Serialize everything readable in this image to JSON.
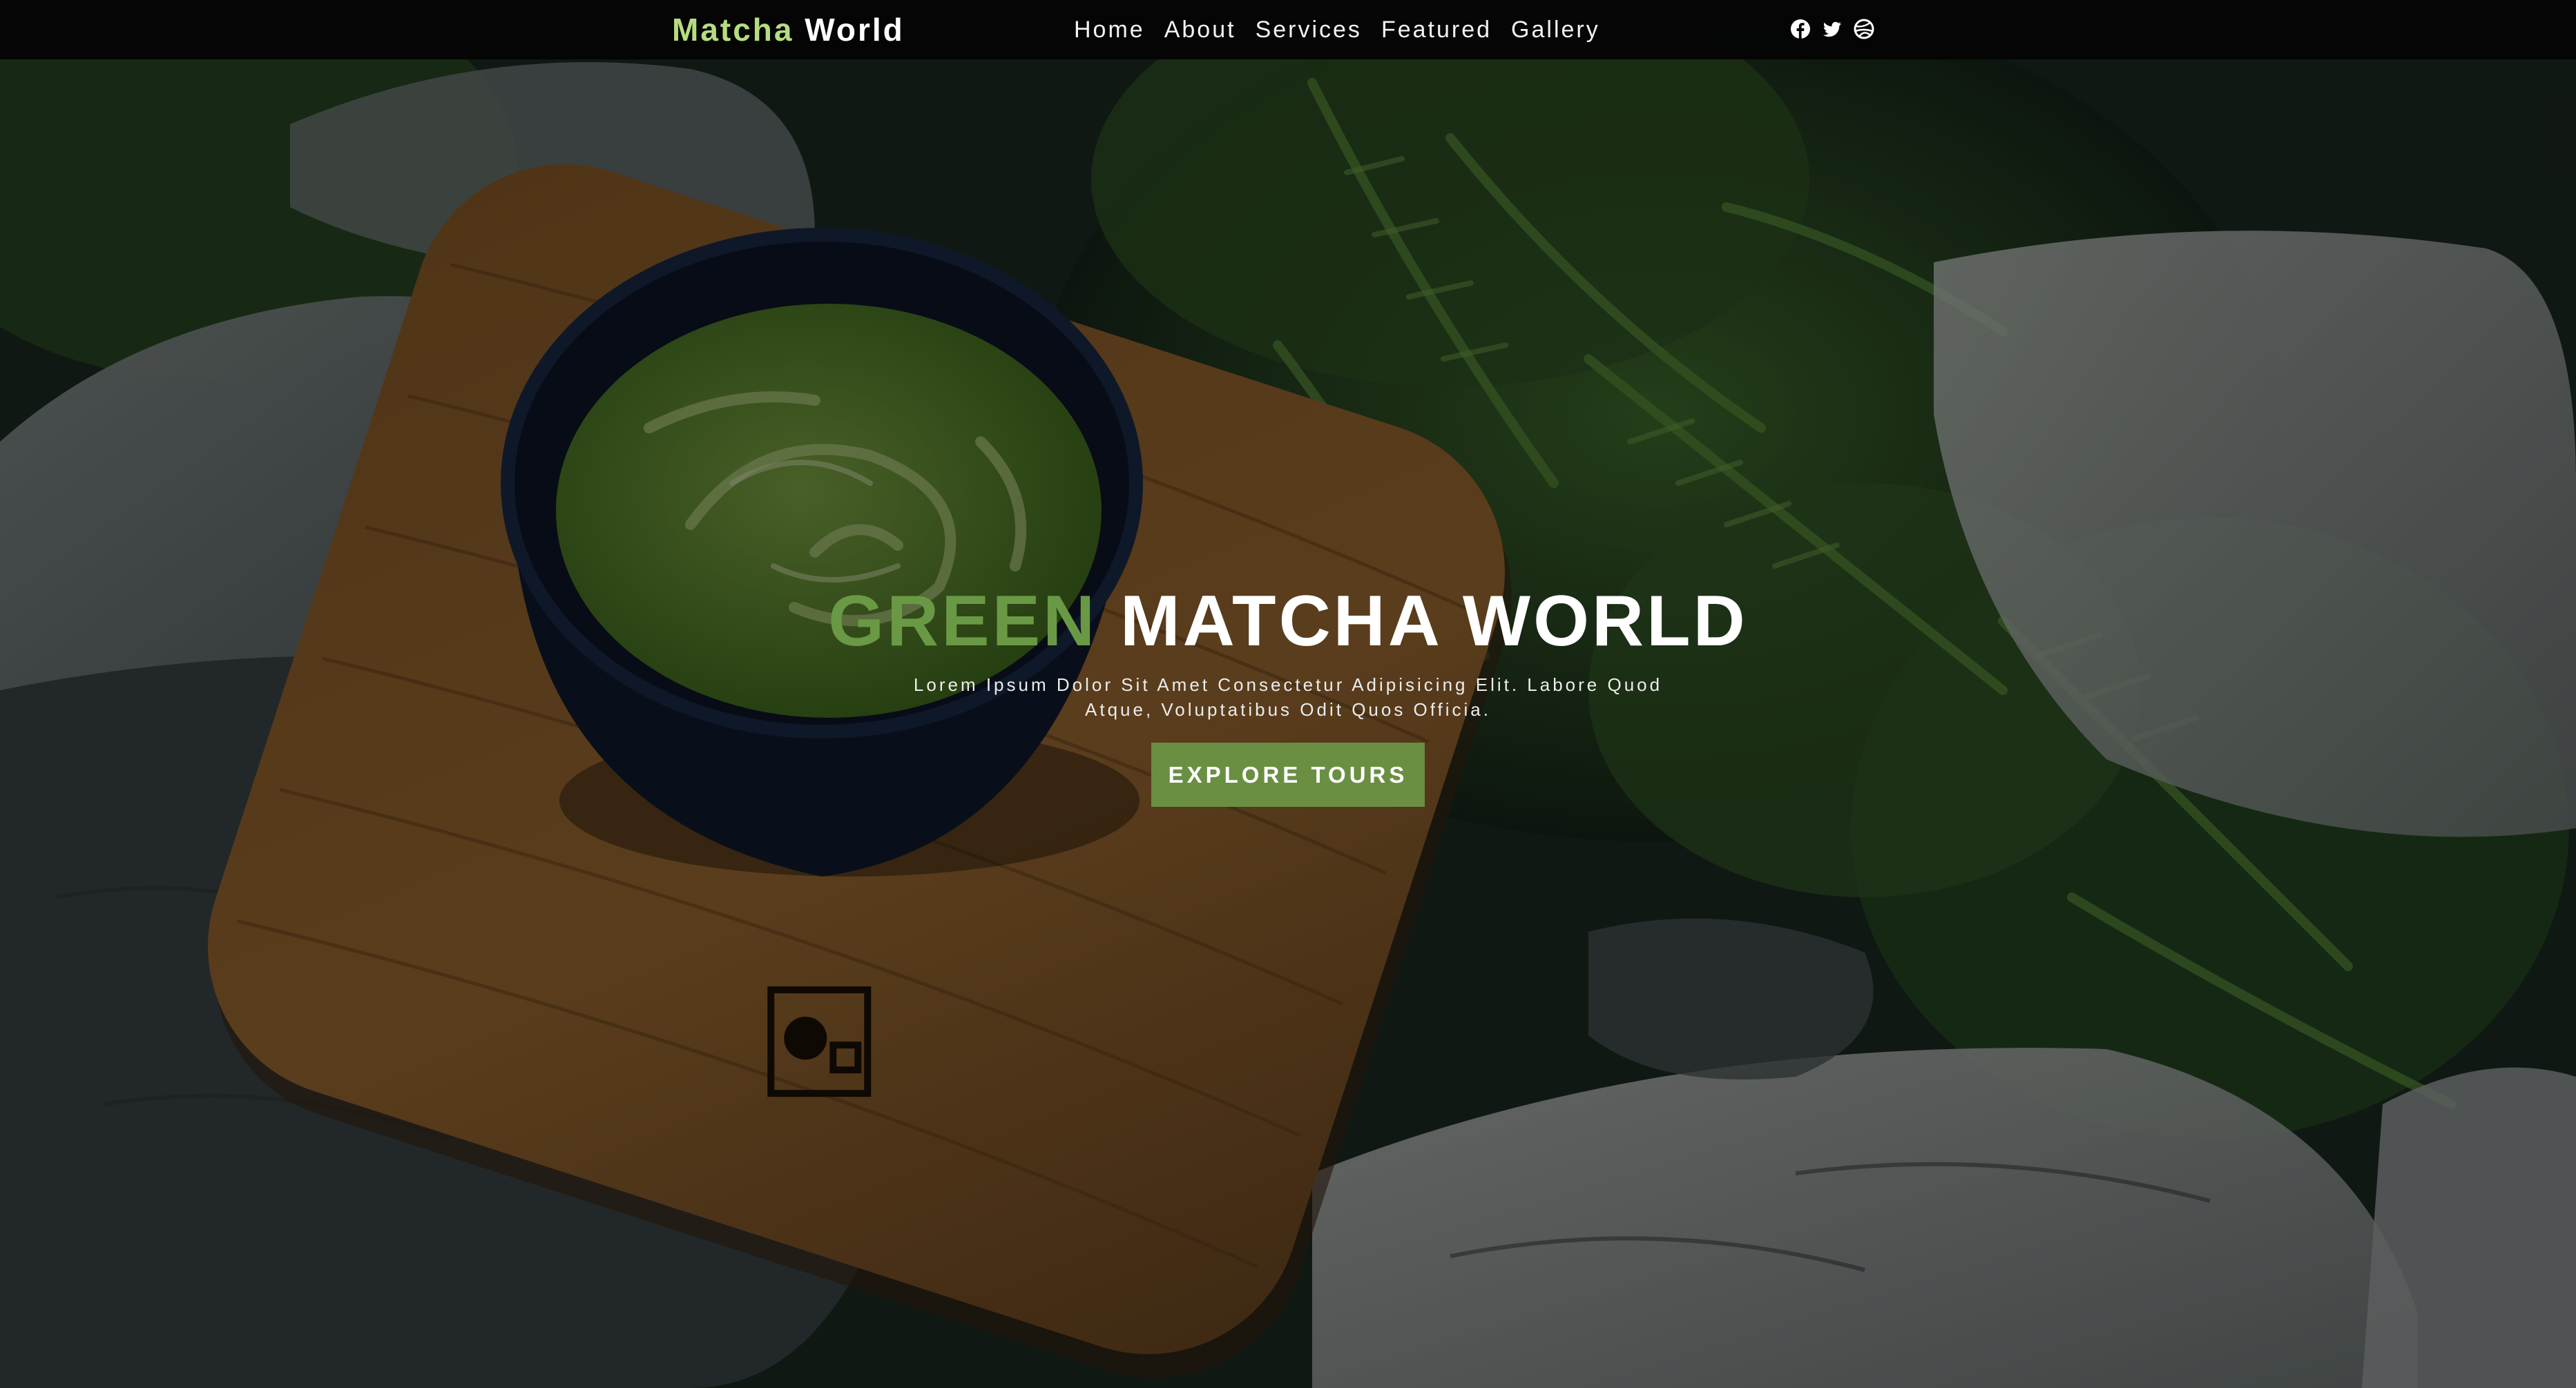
{
  "navbar": {
    "brand": {
      "part1": "Matcha",
      "part2": "World"
    },
    "links": [
      {
        "label": "Home"
      },
      {
        "label": "About"
      },
      {
        "label": "Services"
      },
      {
        "label": "Featured"
      },
      {
        "label": "Gallery"
      }
    ],
    "social_icons": [
      "facebook-icon",
      "twitter-icon",
      "dribbble-icon"
    ]
  },
  "hero": {
    "title_accent": "GREEN",
    "title_rest": "MATCHA WORLD",
    "subtitle": "Lorem Ipsum Dolor Sit Amet Consectetur Adipisicing Elit. Labore Quod Atque, Voluptatibus Odit Quos Officia.",
    "cta_label": "EXPLORE TOURS"
  },
  "colors": {
    "brand_accent": "#b6dc80",
    "title_accent": "#6a9945",
    "button_bg": "#6a8f43",
    "navbar_bg": "#040404"
  }
}
